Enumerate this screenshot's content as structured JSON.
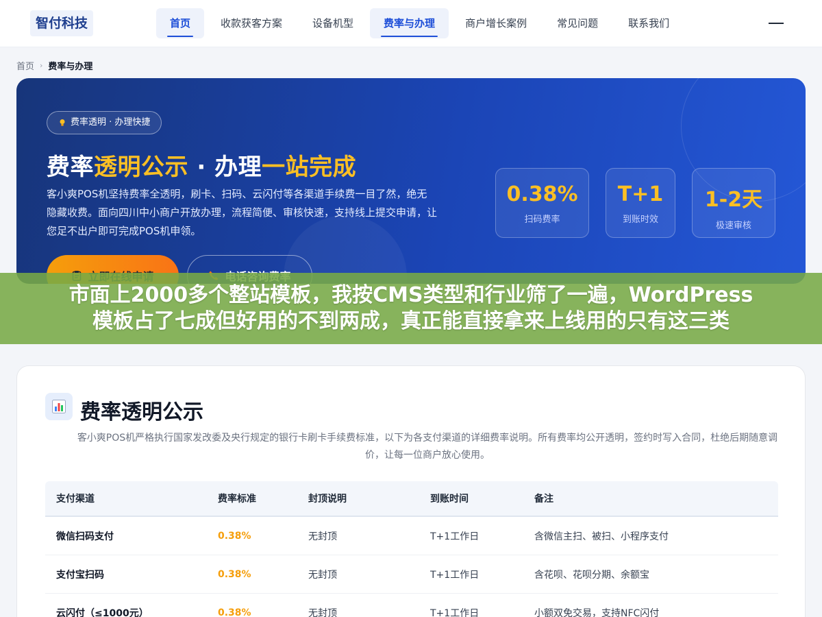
{
  "header": {
    "logo": "智付科技",
    "nav": [
      {
        "label": "首页",
        "active": true
      },
      {
        "label": "收款获客方案",
        "active": false
      },
      {
        "label": "设备机型",
        "active": false
      },
      {
        "label": "费率与办理",
        "active": true
      },
      {
        "label": "商户增长案例",
        "active": false
      },
      {
        "label": "常见问题",
        "active": false
      },
      {
        "label": "联系我们",
        "active": false
      }
    ],
    "menu_icon": "hamburger-icon"
  },
  "breadcrumb": {
    "home": "首页",
    "separator": "›",
    "current": "费率与办理"
  },
  "hero": {
    "badge": "费率透明 · 办理快捷",
    "title_parts": [
      "费率",
      "透明公示",
      " · 办理",
      "一站完成"
    ],
    "description": "客小爽POS机坚持费率全透明，刷卡、扫码、云闪付等各渠道手续费一目了然，绝无隐藏收费。面向四川中小商户开放办理，流程简便、审核快速，支持线上提交申请，让您足不出户即可完成POS机申领。",
    "primary_button": "立即在线申请",
    "secondary_button": "电话咨询费率",
    "stats": [
      {
        "value": "0.38%",
        "label": "扫码费率"
      },
      {
        "value": "T+1",
        "label": "到账时效"
      },
      {
        "value": "1-2天",
        "label": "极速审核"
      }
    ],
    "colors": {
      "accent": "#fbbf24",
      "background": "#1b45b6"
    }
  },
  "overlay": {
    "line1": "市面上2000多个整站模板，我按CMS类型和行业筛了一遍，WordPress",
    "line2": "模板占了七成但好用的不到两成，真正能直接拿来上线用的只有这三类"
  },
  "rates_section": {
    "title": "费率透明公示",
    "description": "客小爽POS机严格执行国家发改委及央行规定的银行卡刷卡手续费标准，以下为各支付渠道的详细费率说明。所有费率均公开透明，签约时写入合同，杜绝后期随意调价，让每一位商户放心使用。",
    "columns": [
      "支付渠道",
      "费率标准",
      "封顶说明",
      "到账时间",
      "备注"
    ],
    "rows": [
      [
        "微信扫码支付",
        "0.38%",
        "无封顶",
        "T+1工作日",
        "含微信主扫、被扫、小程序支付"
      ],
      [
        "支付宝扫码",
        "0.38%",
        "无封顶",
        "T+1工作日",
        "含花呗、花呗分期、余额宝"
      ],
      [
        "云闪付（≤1000元）",
        "0.38%",
        "无封顶",
        "T+1工作日",
        "小额双免交易，支持NFC闪付"
      ]
    ]
  }
}
